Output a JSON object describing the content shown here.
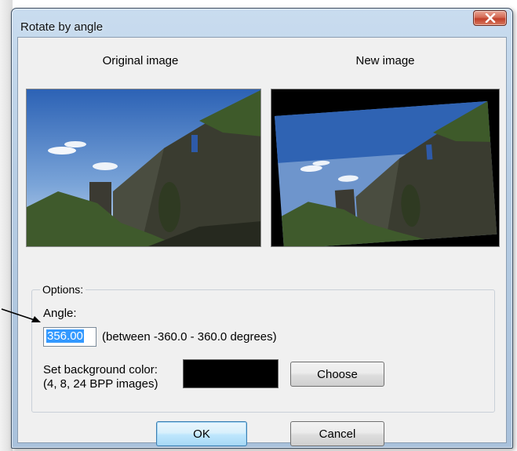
{
  "dialog": {
    "title": "Rotate by angle",
    "close_icon": "close-x-icon"
  },
  "preview": {
    "original_label": "Original image",
    "new_label": "New image"
  },
  "options": {
    "group_label": "Options:",
    "angle_label": "Angle:",
    "angle_value": "356.00",
    "angle_range_text": "(between -360.0  -  360.0 degrees)",
    "bg_color_label_line1": "Set background color:",
    "bg_color_label_line2": "(4, 8, 24 BPP images)",
    "bg_color": "#000000",
    "choose_label": "Choose"
  },
  "buttons": {
    "ok_label": "OK",
    "cancel_label": "Cancel"
  }
}
